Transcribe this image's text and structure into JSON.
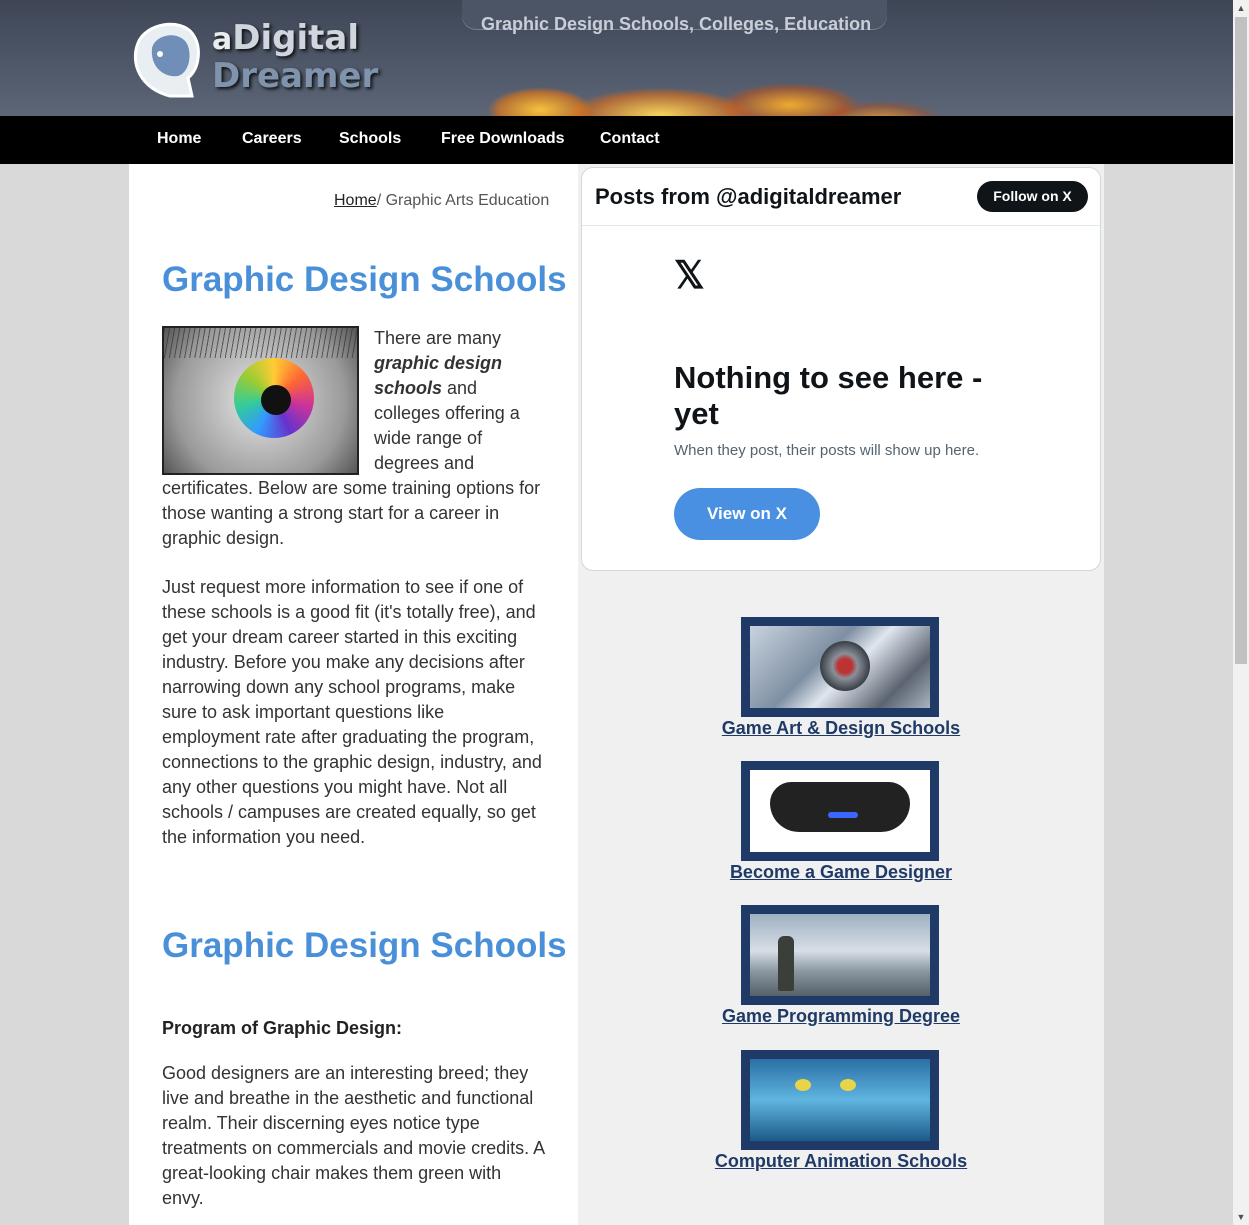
{
  "header": {
    "logo_a": "a",
    "logo_digital": "Digital",
    "logo_dreamer": "Dreamer",
    "tagline": "Graphic Design Schools, Colleges, Education"
  },
  "nav": {
    "items": [
      "Home",
      "Careers",
      "Schools",
      "Free Downloads",
      "Contact"
    ]
  },
  "breadcrumb": {
    "home": "Home",
    "separator": "/",
    "current": " Graphic Arts Education"
  },
  "main": {
    "heading1": "Graphic Design Schools",
    "intro_before": "There are many ",
    "intro_em": "graphic design schools",
    "intro_after": " and colleges offering a wide range of degrees and certificates. Below are some training options for those wanting a strong start for a career in graphic design.",
    "paragraph2": "Just request more information to see if one of these schools is a good fit (it's totally free), and get your dream career started in this exciting industry. Before you make any decisions after narrowing down any school programs, make sure to ask important questions like employment rate after graduating the program, connections to the graphic design, industry, and any other questions you might have. Not all schools / campuses are created equally, so get the information you need.",
    "heading2": "Graphic Design Schools",
    "subheading": "Program of Graphic Design:",
    "paragraph3": "Good designers are an interesting breed; they live and breathe in the aesthetic and functional realm. Their discerning eyes notice type treatments on commercials and movie credits. A great-looking chair makes them green with envy."
  },
  "x_widget": {
    "title": "Posts from @adigitaldreamer",
    "follow_button": "Follow on X",
    "logo": "𝕏",
    "empty_title": "Nothing to see here - yet",
    "empty_sub": "When they post, their posts will show up here.",
    "view_button": "View on X"
  },
  "sidebar": {
    "promos": [
      "Game Art & Design Schools",
      "Become a Game Designer",
      "Game Programming Degree",
      "Computer Animation Schools"
    ]
  },
  "colors": {
    "accent_heading": "#4a90d9",
    "nav_bg": "#000000",
    "promo_frame": "#1f3a66",
    "x_button": "#4a90e2"
  }
}
